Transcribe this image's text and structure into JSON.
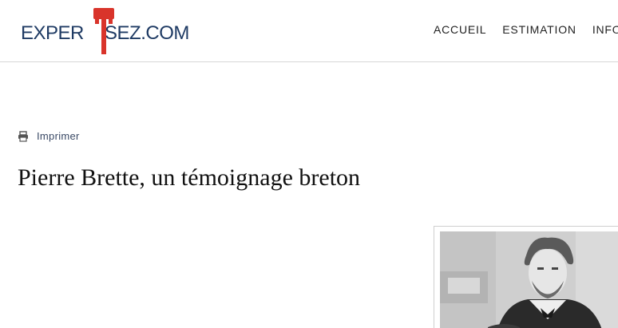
{
  "brand": {
    "logo_text_left": "EXPER",
    "logo_text_right": "ISEZ.COM",
    "colors": {
      "navy": "#1f3b64",
      "red": "#d9342b"
    }
  },
  "nav": {
    "items": [
      {
        "label": "ACCUEIL"
      },
      {
        "label": "ESTIMATION"
      },
      {
        "label": "INFO"
      }
    ]
  },
  "article": {
    "print_label": "Imprimer",
    "print_icon": "printer-icon",
    "title": "Pierre Brette, un témoignage breton"
  }
}
